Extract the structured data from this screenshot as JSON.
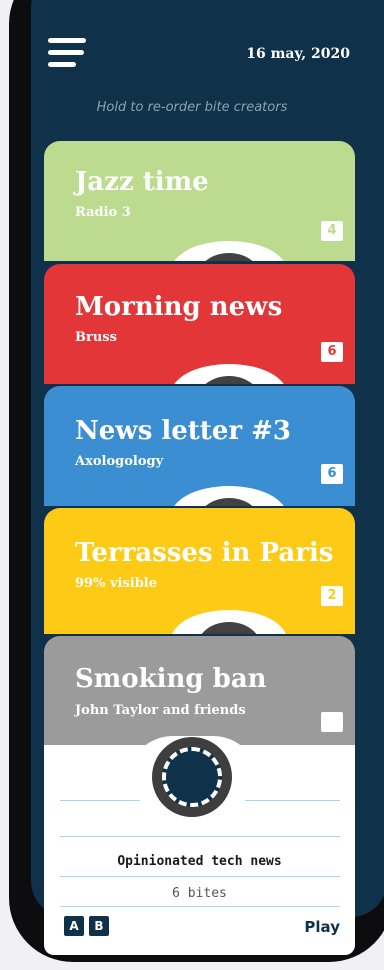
{
  "header": {
    "date": "16 may, 2020",
    "hint": "Hold to re-order bite creators"
  },
  "cards": [
    {
      "title": "Jazz time",
      "subtitle": "Radio 3",
      "count": "4",
      "color": "#bcdb8f"
    },
    {
      "title": "Morning news",
      "subtitle": "Bruss",
      "count": "6",
      "color": "#e23638"
    },
    {
      "title": "News letter #3",
      "subtitle": "Axologology",
      "count": "6",
      "color": "#3b8ed1"
    },
    {
      "title": "Terrasses in Paris",
      "subtitle": "99% visible",
      "count": "2",
      "color": "#fdcb16"
    },
    {
      "title": "Smoking ban",
      "subtitle": "John Taylor and friends",
      "count": "",
      "color": "#9b9b9b"
    }
  ],
  "current": {
    "title": "Opinionated tech news",
    "bites": "6 bites",
    "option_a": "A",
    "option_b": "B",
    "play_label": "Play"
  },
  "colors": {
    "navy": "#0f3149",
    "reel": "#3e3e3e"
  }
}
